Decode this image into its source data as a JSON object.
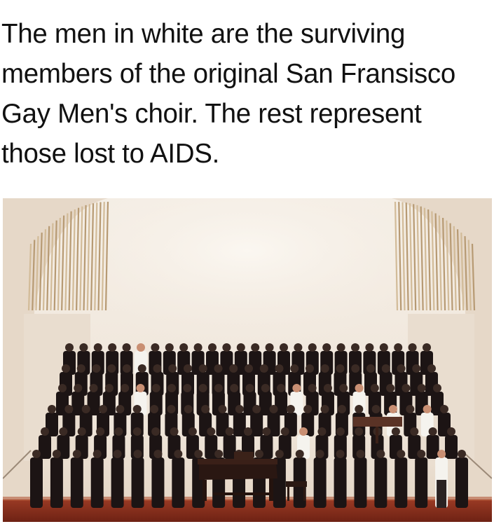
{
  "caption": {
    "lines": [
      "The men in white are the surviving",
      "members of the original San Fransisco",
      "Gay Men's choir. The rest represent",
      "those lost to AIDS."
    ]
  },
  "photo": {
    "subject": "choir-on-stage-photo",
    "colors": {
      "wall": "#f2ebe2",
      "wall_shadow": "#d9cbbb",
      "wood_slats": "#b79a73",
      "suit": "#1c1414",
      "white_shirt": "#f5f3ee",
      "face": "#c98f73",
      "stage_floor": "#8a2e1c",
      "piano": "#2a1712"
    },
    "choir": {
      "rows": 6,
      "figures_per_row": [
        26,
        25,
        25,
        24,
        23,
        22
      ]
    },
    "white_shirted_members": 8
  }
}
